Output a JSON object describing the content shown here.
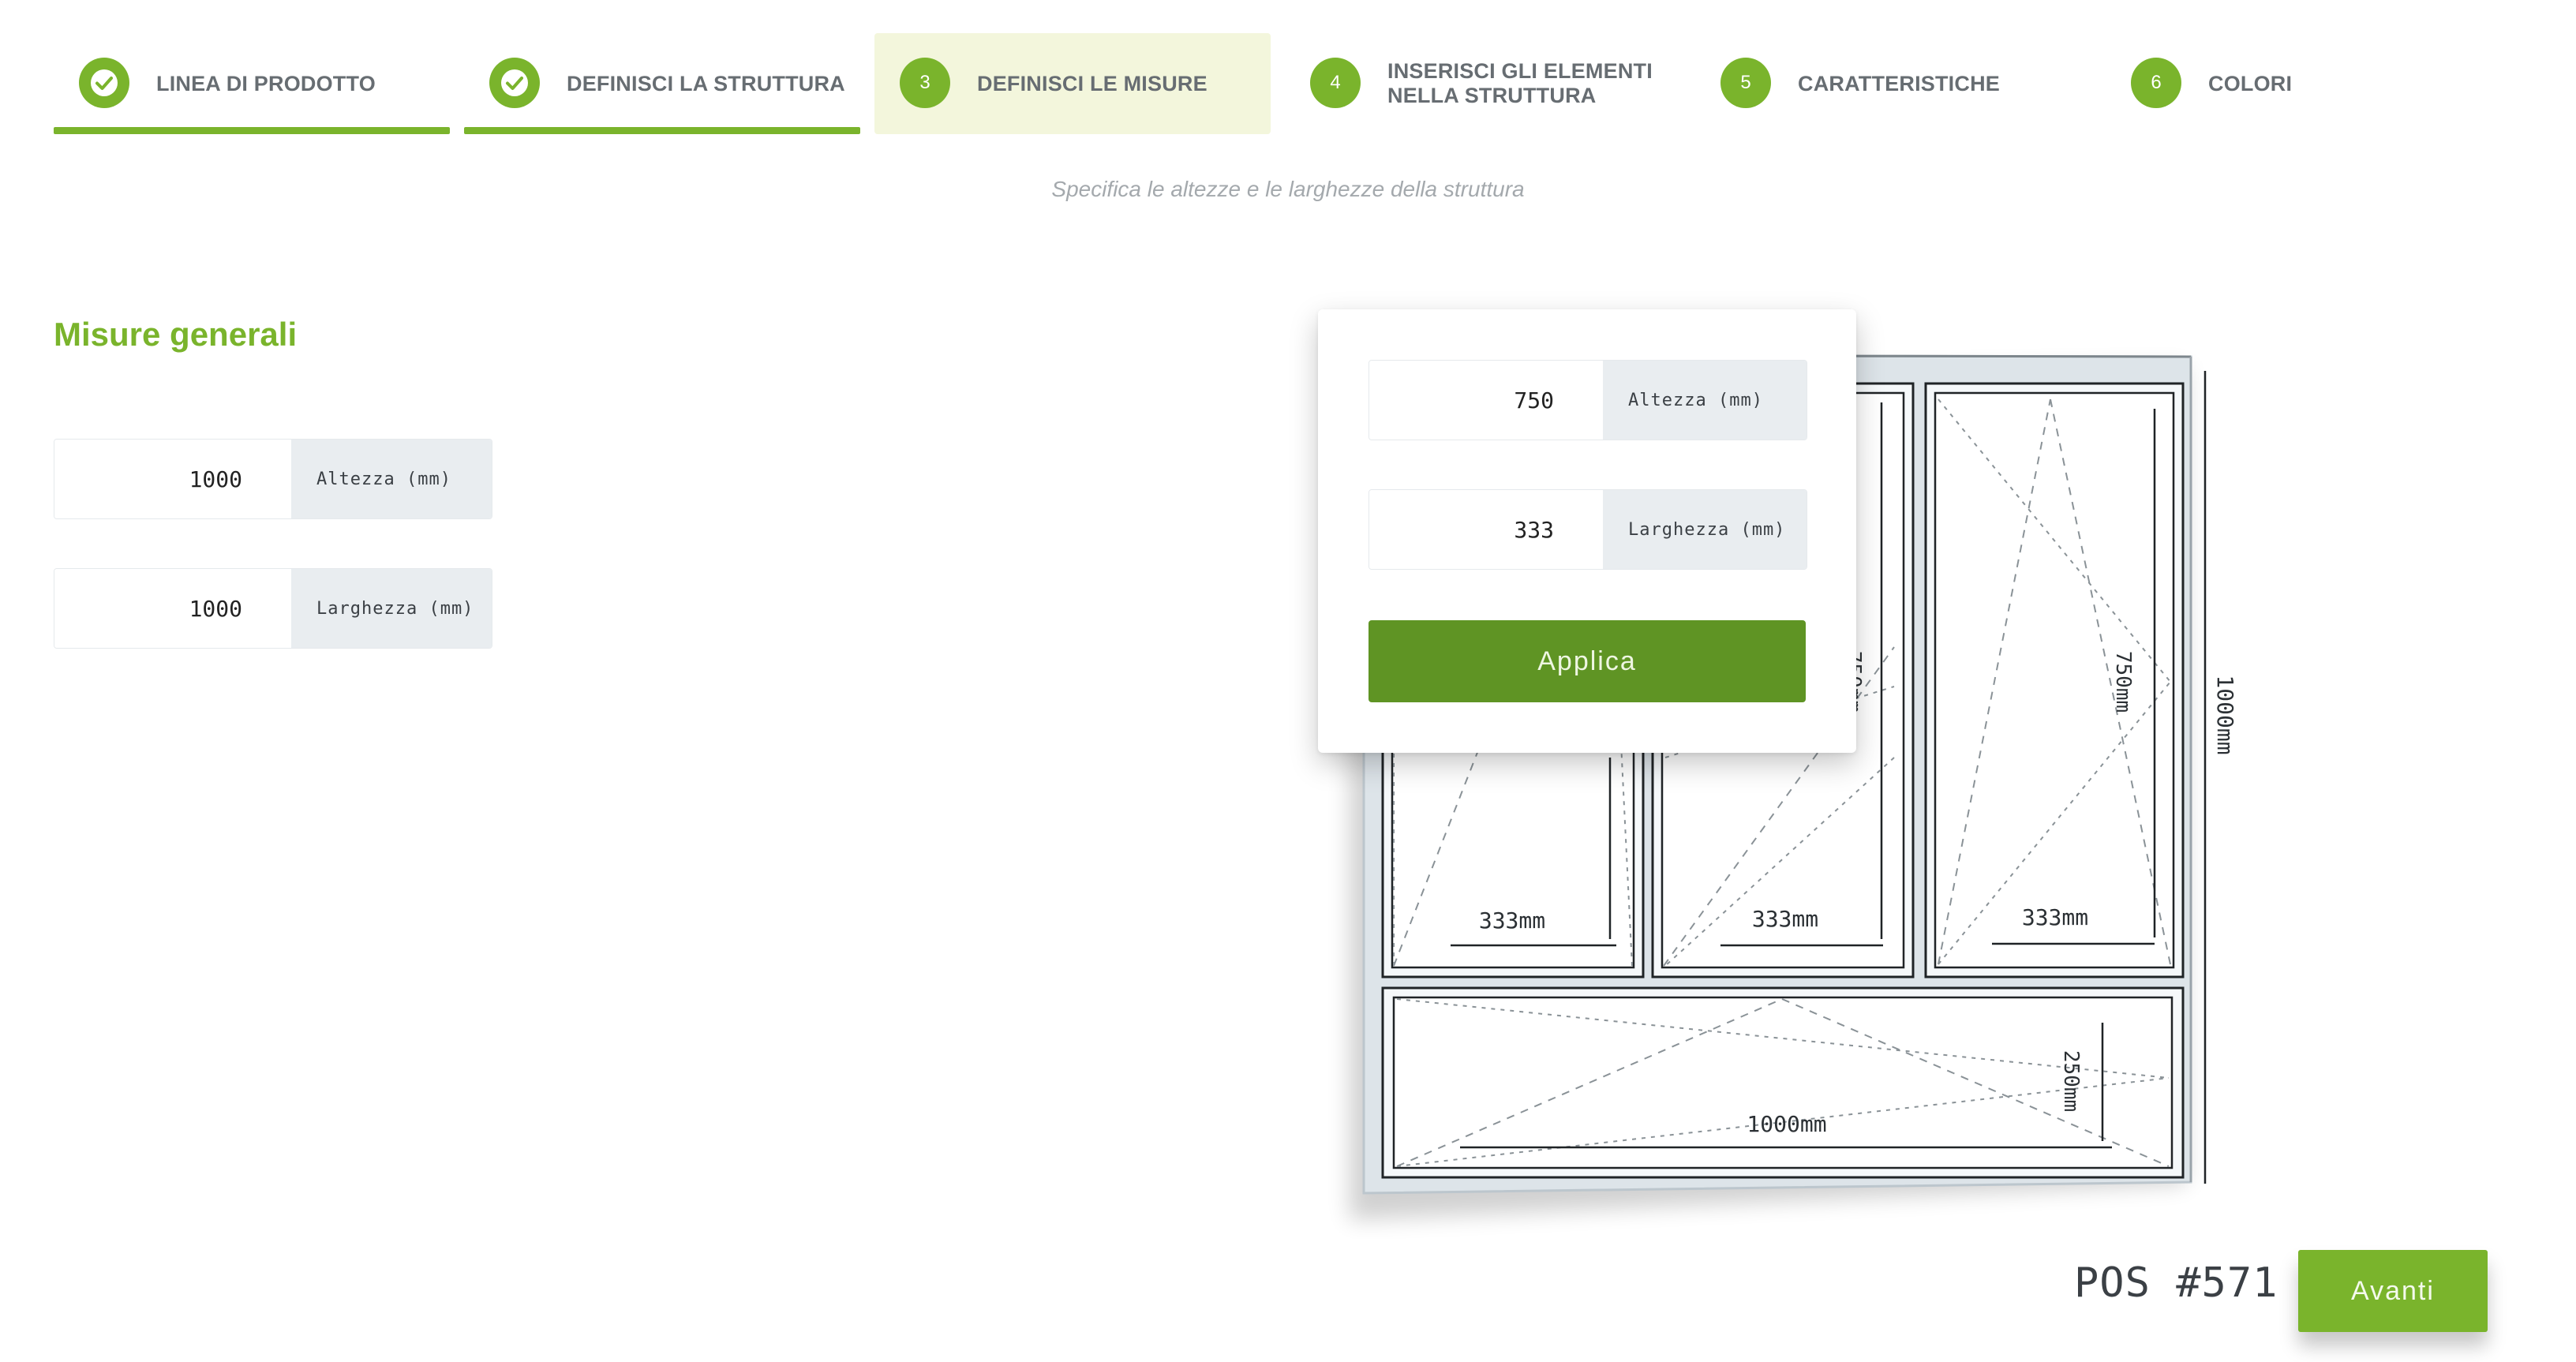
{
  "stepper": {
    "steps": [
      {
        "number": "1",
        "label": "LINEA DI PRODOTTO",
        "state": "done"
      },
      {
        "number": "2",
        "label": "DEFINISCI LA STRUTTURA",
        "state": "done"
      },
      {
        "number": "3",
        "label": "DEFINISCI LE MISURE",
        "state": "active"
      },
      {
        "number": "4",
        "label": "INSERISCI GLI ELEMENTI NELLA STRUTTURA",
        "state": "pending"
      },
      {
        "number": "5",
        "label": "CARATTERISTICHE",
        "state": "pending"
      },
      {
        "number": "6",
        "label": "COLORI",
        "state": "pending"
      }
    ]
  },
  "subtitle": "Specifica le altezze e le larghezze della struttura",
  "general": {
    "title": "Misure generali",
    "height": {
      "value": "1000",
      "unit": "Altezza (mm)"
    },
    "width": {
      "value": "1000",
      "unit": "Larghezza (mm)"
    }
  },
  "popup": {
    "height": {
      "value": "750",
      "unit": "Altezza (mm)"
    },
    "width": {
      "value": "333",
      "unit": "Larghezza (mm)"
    },
    "apply_label": "Applica"
  },
  "diagram": {
    "total_height_label": "1000mm",
    "top_panel_height_label": "750mm",
    "top_panel_width_label": "333mm",
    "bottom_panel_width_label": "1000mm",
    "bottom_panel_height_label": "250mm"
  },
  "footer": {
    "pos_label": "POS #571",
    "next_label": "Avanti"
  },
  "colors": {
    "accent": "#7ab42c",
    "accent_dark": "#5f9424",
    "active_step_bg": "#f3f6dc"
  }
}
